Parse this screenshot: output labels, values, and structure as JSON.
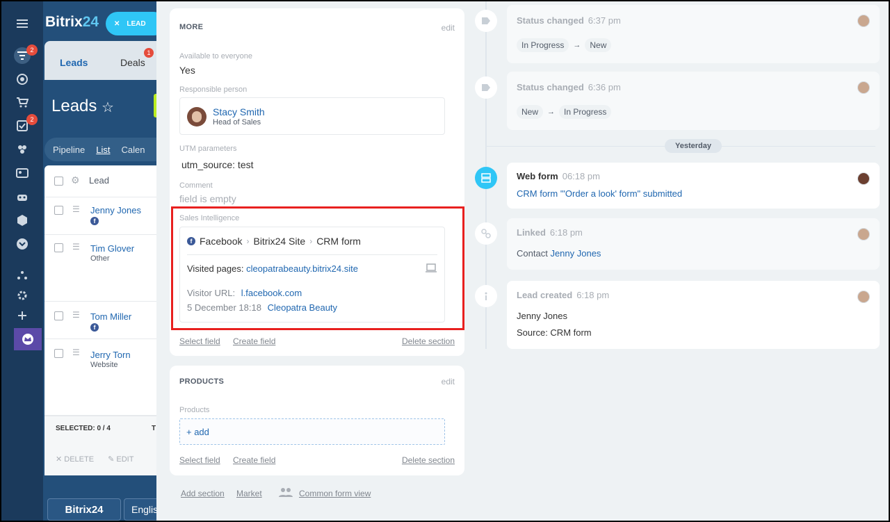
{
  "background": {
    "logo_main": "Bitrix",
    "logo_num": "24",
    "lead_chip": "LEAD",
    "tabs": {
      "leads": "Leads",
      "deals": "Deals",
      "deals_badge": "1"
    },
    "title": "Leads",
    "views": [
      "Pipeline",
      "List",
      "Calen"
    ],
    "grid_header": "Lead",
    "rows": [
      {
        "name": "Jenny Jones",
        "sub": "f"
      },
      {
        "name": "Tim Glover",
        "sub": "Other"
      },
      {
        "name": "Tom Miller",
        "sub": "f"
      },
      {
        "name": "Jerry Torn",
        "sub": "Website"
      }
    ],
    "selected": "SELECTED: 0 / 4",
    "selected_extra": "T",
    "actions": {
      "delete": "DELETE",
      "edit": "EDIT"
    },
    "bottom_logo": "Bitrix24",
    "bottom_lang": "Englis",
    "nav_badges": {
      "filter": "2",
      "tasks": "2"
    }
  },
  "more_section": {
    "title": "MORE",
    "edit": "edit",
    "available_label": "Available to everyone",
    "available_value": "Yes",
    "responsible_label": "Responsible person",
    "responsible_name": "Stacy Smith",
    "responsible_role": "Head of Sales",
    "utm_label": "UTM parameters",
    "utm_value": "utm_source: test",
    "comment_label": "Comment",
    "comment_value": "field is empty",
    "si_label": "Sales Intelligence",
    "si_path": [
      "Facebook",
      "Bitrix24 Site",
      "CRM form"
    ],
    "visited_label": "Visited pages:",
    "visited_value": "cleopatrabeauty.bitrix24.site",
    "visitor_url_label": "Visitor URL:",
    "visitor_url_value": "l.facebook.com",
    "visit_date": "5 December 18:18",
    "visit_site": "Cleopatra Beauty",
    "select_field": "Select field",
    "create_field": "Create field",
    "delete_section": "Delete section"
  },
  "products_section": {
    "title": "PRODUCTS",
    "edit": "edit",
    "products_label": "Products",
    "add": "+ add",
    "select_field": "Select field",
    "create_field": "Create field",
    "delete_section": "Delete section"
  },
  "bottom_links": {
    "add_section": "Add section",
    "market": "Market",
    "common_form_view": "Common form view"
  },
  "timeline": [
    {
      "title": "Status changed",
      "time": "6:37 pm",
      "from": "In Progress",
      "to": "New"
    },
    {
      "title": "Status changed",
      "time": "6:36 pm",
      "from": "New",
      "to": "In Progress"
    },
    {
      "title": "Web form",
      "time": "06:18 pm",
      "text": "CRM form \"'Order a look' form\" submitted"
    },
    {
      "title": "Linked",
      "time": "6:18 pm",
      "prefix": "Contact",
      "contact": "Jenny Jones"
    },
    {
      "title": "Lead created",
      "time": "6:18 pm",
      "line1": "Jenny Jones",
      "line2": "Source: CRM form"
    }
  ],
  "timeline_separator": "Yesterday",
  "colors": {
    "highlight": "#e8201f",
    "accent": "#2fc6f6",
    "link": "#2067b0",
    "nav": "#1b3a5c"
  }
}
